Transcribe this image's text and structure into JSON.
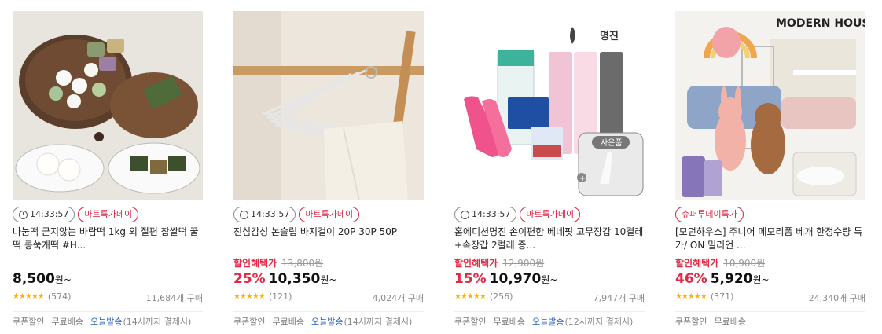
{
  "products": [
    {
      "image_desc": "rice-cake-photo",
      "time_badge": "14:33:57",
      "event_badge": "마트특가데이",
      "title": "나눔떡 굳지않는 바람떡 1kg 외 절편 찹쌀떡 꿀떡 콩쑥개떡 #H...",
      "discount_label": "",
      "original_price": "",
      "discount_pct": "",
      "price": "8,500",
      "won": "원~",
      "rating_count": "(574)",
      "buy_count": "11,684개 구매",
      "badge_coupon": "쿠폰할인",
      "badge_ship": "무료배송",
      "badge_today": "오늘발송",
      "badge_note": "(14시까지 결제시)"
    },
    {
      "image_desc": "pants-hanger-photo",
      "time_badge": "14:33:57",
      "event_badge": "마트특가데이",
      "title": "진심감성 논슬립 바지걸이 20P 30P 50P",
      "discount_label": "할인혜택가",
      "original_price": "13,800원",
      "discount_pct": "25%",
      "price": "10,350",
      "won": "원~",
      "rating_count": "(121)",
      "buy_count": "4,024개 구매",
      "badge_coupon": "쿠폰할인",
      "badge_ship": "무료배송",
      "badge_today": "오늘발송",
      "badge_note": "(14시까지 결제시)"
    },
    {
      "image_desc": "rubber-gloves-photo",
      "time_badge": "14:33:57",
      "event_badge": "마트특가데이",
      "title": "홈에디션명진 손이편한 베네핏 고무장갑 10켤레+속장갑 2켤레 증...",
      "discount_label": "할인혜택가",
      "original_price": "12,900원",
      "discount_pct": "15%",
      "price": "10,970",
      "won": "원~",
      "rating_count": "(256)",
      "buy_count": "7,947개 구매",
      "badge_coupon": "쿠폰할인",
      "badge_ship": "무료배송",
      "badge_today": "오늘발송",
      "badge_note": "(12시까지 결제시)",
      "brand_mark": "홈에디션 명진",
      "gift_label": "사은품"
    },
    {
      "image_desc": "modern-house-room-photo",
      "time_badge": "",
      "event_badge": "슈퍼투데이특가",
      "title": "[모던하우스] 주니어 메모리폼 베개 한정수량 특가/ ON 밀리언 ...",
      "discount_label": "할인혜택가",
      "original_price": "10,900원",
      "discount_pct": "46%",
      "price": "5,920",
      "won": "원~",
      "rating_count": "(371)",
      "buy_count": "24,340개 구매",
      "badge_coupon": "쿠폰할인",
      "badge_ship": "무료배송",
      "badge_today": "",
      "badge_note": "",
      "brand_mark": "MODERN HOUSE"
    }
  ],
  "colors": {
    "accent_red": "#e22a42",
    "star": "#ffb400",
    "link_blue": "#2660c4"
  }
}
